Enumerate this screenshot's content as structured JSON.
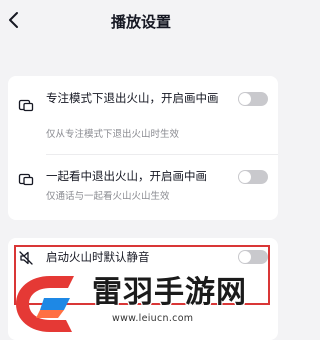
{
  "header": {
    "title": "播放设置"
  },
  "icons": {
    "back": "chevron-left-icon",
    "exit_window": "window-exit-icon",
    "speaker_mute": "speaker-mute-icon"
  },
  "settings": [
    {
      "title": "专注模式下退出火山，开启画中画",
      "description": "仅从专注模式下退出火山时生效",
      "enabled": false
    },
    {
      "title": "一起看中退出火山，开启画中画",
      "description": "仅通话与一起看火山火山生效",
      "enabled": false
    },
    {
      "title": "启动火山时默认静音",
      "enabled": false
    }
  ],
  "colors": {
    "highlight_border": "#d93636",
    "toggle_off": "#c9c9cd",
    "page_bg": "#f3f3f5"
  },
  "watermark": {
    "text": "雷羽手游网",
    "url": "www.leiucn.com",
    "logo": "watermark-logo"
  }
}
